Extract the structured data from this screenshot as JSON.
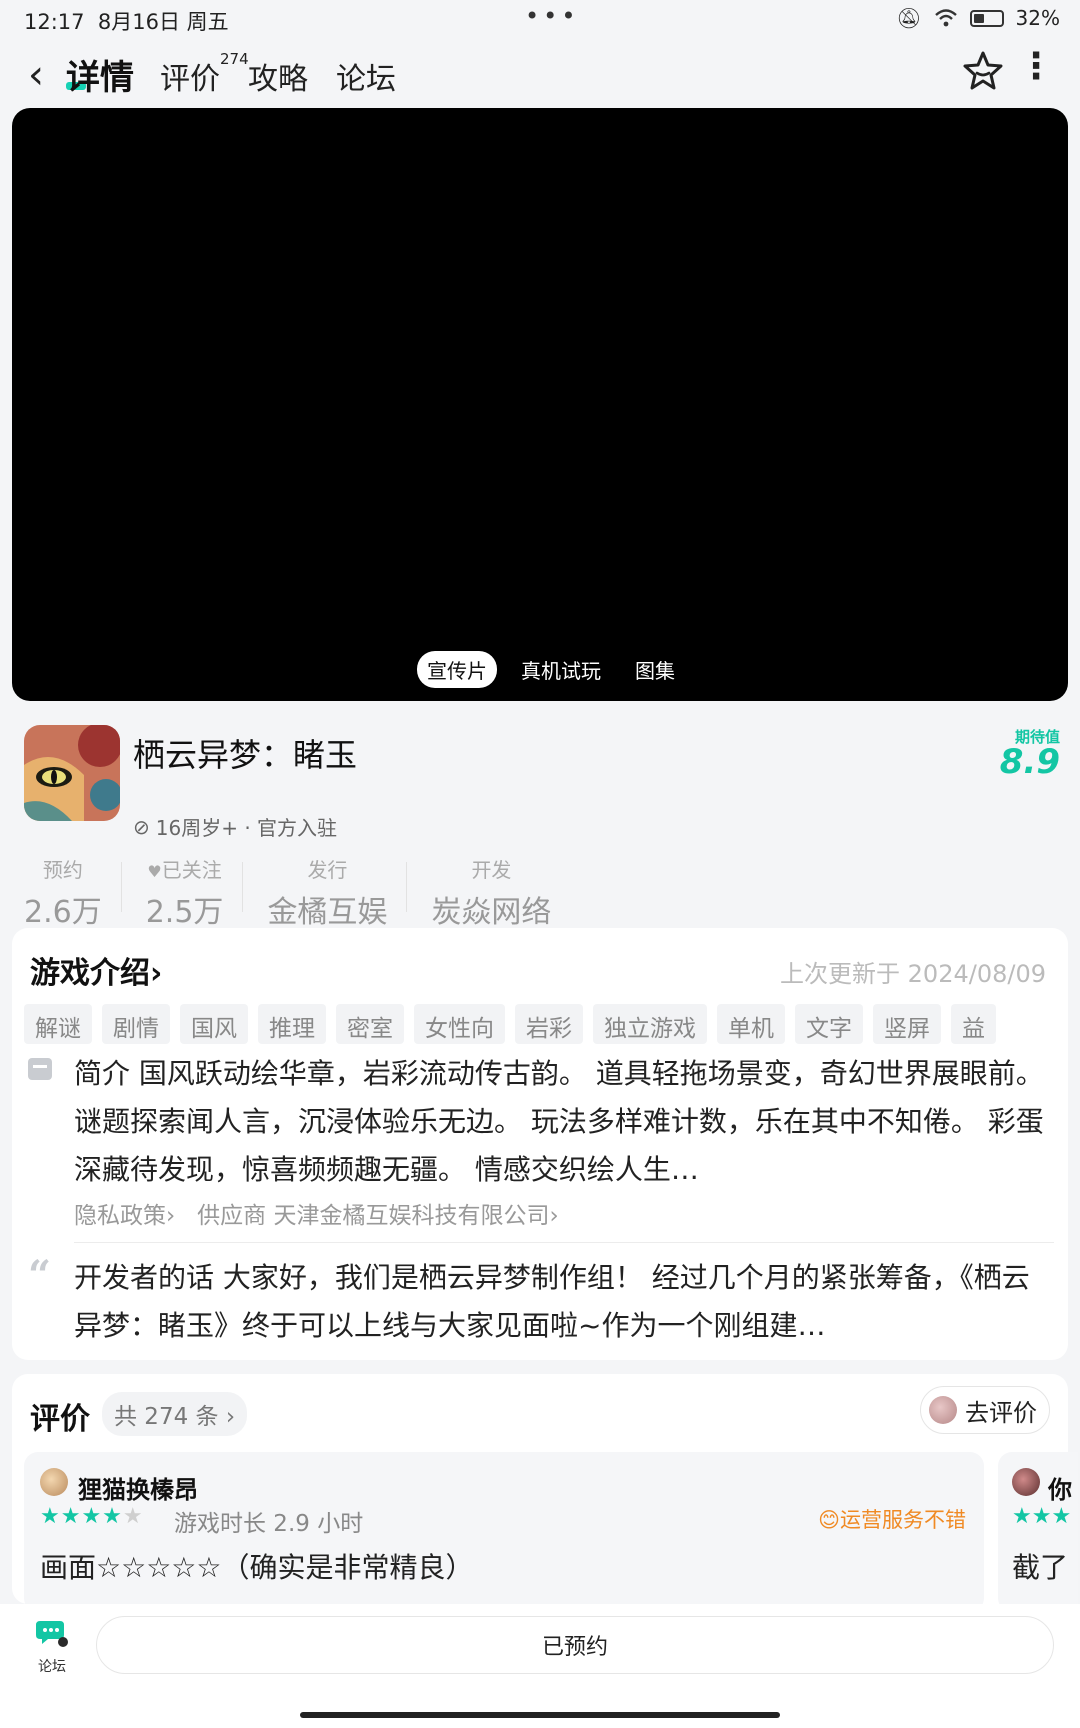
{
  "status": {
    "time": "12:17",
    "date": "8月16日 周五",
    "battery": "32%"
  },
  "nav": {
    "active_tab": "详情",
    "tabs": [
      {
        "label": "评价",
        "count": "274"
      },
      {
        "label": "攻略"
      },
      {
        "label": "论坛"
      }
    ]
  },
  "video": {
    "tabs": [
      "宣传片",
      "真机试玩",
      "图集"
    ],
    "active_tab": "宣传片"
  },
  "game": {
    "title": "栖云异梦：睹玉",
    "age_info": "16周岁+ · 官方入驻",
    "expect_label": "期待值",
    "expect_value": "8.9",
    "stats": [
      {
        "label": "预约",
        "value": "2.6万"
      },
      {
        "label": "已关注",
        "value": "2.5万"
      },
      {
        "label": "发行",
        "value": "金橘互娱"
      },
      {
        "label": "开发",
        "value": "炭焱网络"
      }
    ]
  },
  "intro": {
    "title": "游戏介绍",
    "title_arrow": "›",
    "updated": "上次更新于 2024/08/09",
    "tags": [
      "解谜",
      "剧情",
      "国风",
      "推理",
      "密室",
      "女性向",
      "岩彩",
      "独立游戏",
      "单机",
      "文字",
      "竖屏",
      "益"
    ],
    "description": "简介 国风跃动绘华章，岩彩流动传古韵。 道具轻拖场景变，奇幻世界展眼前。 谜题探索闻人言，沉浸体验乐无边。 玩法多样难计数，乐在其中不知倦。 彩蛋深藏待发现，惊喜频频趣无疆。 情感交织绘人生…",
    "privacy_link": "隐私政策›",
    "supplier": "供应商 天津金橘互娱科技有限公司›",
    "dev_words": "开发者的话 大家好，我们是栖云异梦制作组！ 经过几个月的紧张筹备，《栖云异梦：睹玉》终于可以上线与大家见面啦~作为一个刚组建…"
  },
  "reviews": {
    "title": "评价",
    "count": "共 274 条 ›",
    "go_review": "去评价",
    "items": [
      {
        "name": "狸猫换榛昂",
        "stars_on": "★★★★",
        "stars_off": "★",
        "playtime": "游戏时长 2.9 小时",
        "badge": "😊运营服务不错",
        "text": "画面☆☆☆☆☆（确实是非常精良）"
      },
      {
        "name": "你",
        "stars_on": "★★★",
        "text": "截了"
      }
    ]
  },
  "bottom": {
    "forum_label": "论坛",
    "reserve_label": "已预约"
  },
  "colors": {
    "accent": "#13c6a4",
    "badge": "#f08a24"
  }
}
